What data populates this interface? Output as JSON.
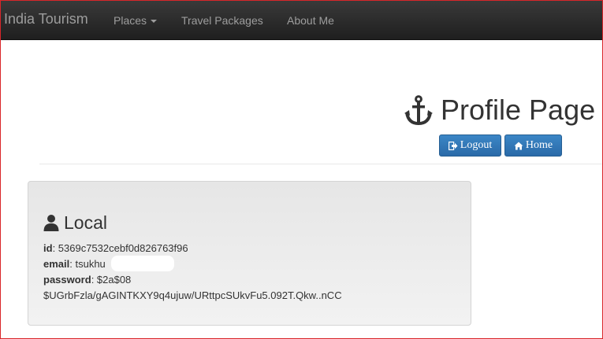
{
  "navbar": {
    "brand": "India Tourism",
    "items": [
      {
        "label": "Places",
        "has_dropdown": true
      },
      {
        "label": "Travel Packages",
        "has_dropdown": false
      },
      {
        "label": "About Me",
        "has_dropdown": false
      }
    ]
  },
  "header": {
    "icon": "anchor-icon",
    "title": "Profile Page",
    "buttons": [
      {
        "label": "Logout",
        "icon": "sign-out-icon"
      },
      {
        "label": "Home",
        "icon": "home-icon"
      }
    ]
  },
  "local": {
    "icon": "user-icon",
    "title": "Local",
    "fields": {
      "id_label": "id",
      "id_value": ": 5369c7532cebf0d826763f96",
      "email_label": "email",
      "email_value": ": tsukhu",
      "password_label": "password",
      "password_value": ": $2a$08",
      "password_value_cont": "$UGrbFzla/gAGINTKXY9q4ujuw/URttpcSUkvFu5.092T.Qkw..nCC"
    }
  },
  "colors": {
    "navbar": "#222222",
    "nav_text": "#9d9d9d",
    "button": "#3071a9",
    "frame": "#d9262a"
  }
}
